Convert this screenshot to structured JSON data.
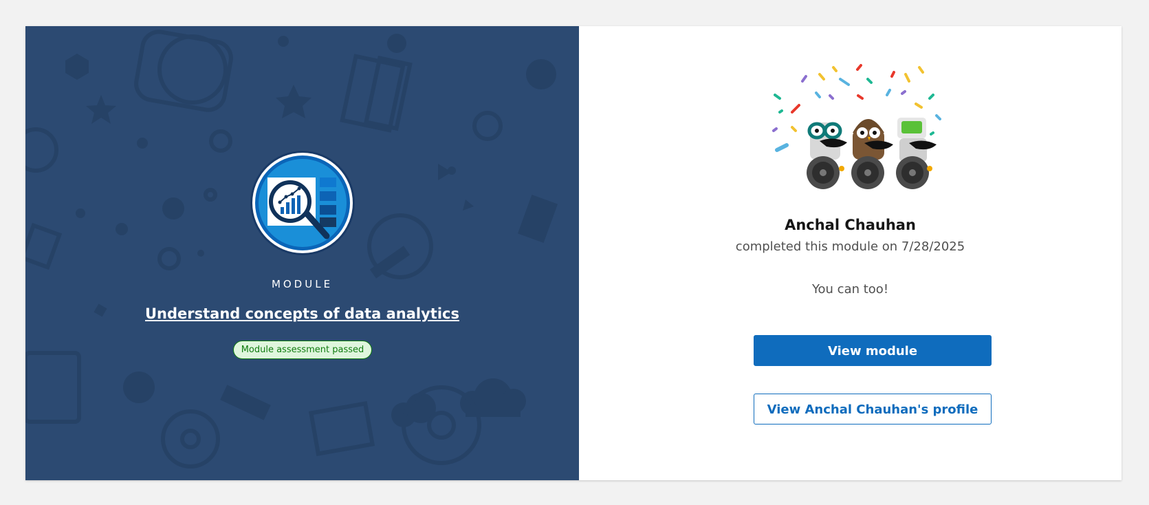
{
  "module": {
    "kicker": "MODULE",
    "title": "Understand concepts of data analytics",
    "badge": "Module assessment passed",
    "icon": "data-analytics-magnifier-icon"
  },
  "achievement": {
    "learner_name": "Anchal Chauhan",
    "completed_text": "completed this module on 7/28/2025",
    "cta_text": "You can too!",
    "illustration": "celebrating-robots-with-confetti"
  },
  "actions": {
    "view_module": "View module",
    "view_profile": "View Anchal Chauhan's profile"
  },
  "colors": {
    "page_bg": "#f2f2f2",
    "left_panel_bg": "#2c4a72",
    "accent_blue": "#0f6cbd",
    "badge_green": "#107c10",
    "badge_bg": "#dff6dd"
  }
}
